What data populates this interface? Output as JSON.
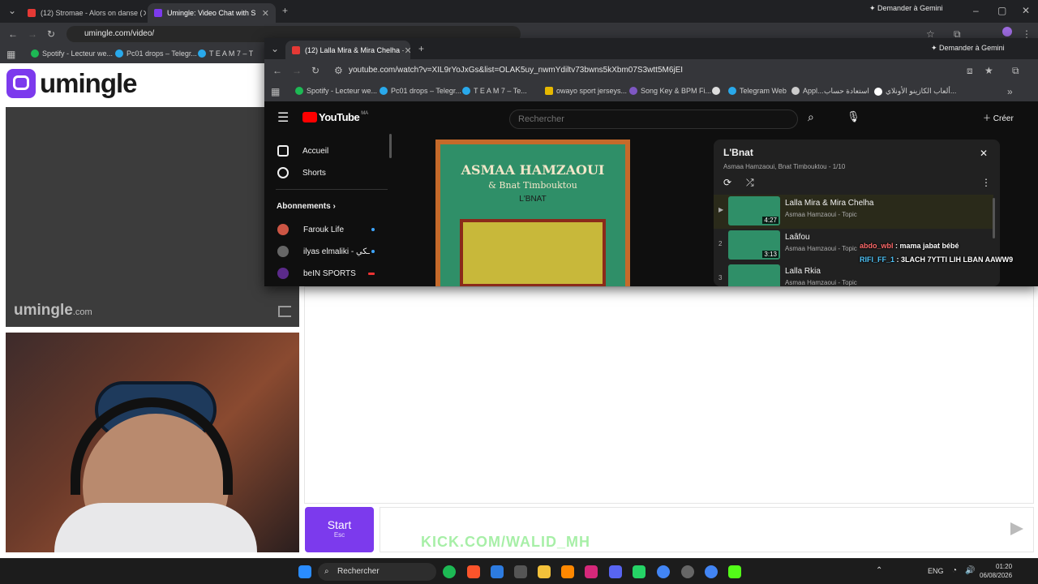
{
  "back_browser": {
    "tabs": [
      {
        "title": "(12) Stromae - Alors on danse (",
        "favicon_color": "#e53935",
        "active": false
      },
      {
        "title": "Umingle: Video Chat with S",
        "favicon_color": "#7c3aed",
        "active": true
      }
    ],
    "gemini_label": "Demander à Gemini",
    "url": "umingle.com/video/",
    "bookmarks": [
      "Spotify - Lecteur we...",
      "Pc01 drops – Telegr...",
      "T E A M 7 – T"
    ]
  },
  "umingle": {
    "logo_text": "umingle",
    "watermark": "umingle",
    "watermark_suffix": ".com",
    "start_label": "Start",
    "start_key": "Esc",
    "stream_watermark": "KICK.COM/WALID_MH"
  },
  "front_browser": {
    "tab_title": "(12) Lalla Mira & Mira Chelha ·",
    "gemini_label": "Demander à Gemini",
    "url": "youtube.com/watch?v=XIL9rYoJxGs&list=OLAK5uy_nwmYdiltv73bwns5kXbm07S3wtt5M6jEI",
    "bookmarks": [
      "Spotify - Lecteur we...",
      "Pc01 drops – Telegr...",
      "T E A M 7 – Te...",
      "owayo sport jerseys...",
      "Song Key & BPM Fi...",
      "Telegram Web",
      "Appl...",
      "استعادة حساب",
      "ألعاب الكازينو الأونلاي..."
    ]
  },
  "youtube": {
    "logo": "YouTube",
    "region": "MA",
    "search_placeholder": "Rechercher",
    "create_label": "Créer",
    "nav": [
      "Accueil",
      "Shorts"
    ],
    "subscriptions_header": "Abonnements",
    "subscriptions": [
      "Farouk Life",
      "ilyas elmaliki - ـكي",
      "beIN SPORTS"
    ],
    "album_artist": "ASMAA HAMZAOUI",
    "album_band": "& Bnat Timbouktou",
    "album_title": "L'BNAT",
    "playlist": {
      "title": "L'Bnat",
      "subtitle": "Asmaa Hamzaoui, Bnat Timbouktou - 1/10",
      "items": [
        {
          "index": "▶",
          "title": "Lalla Mira & Mira Chelha",
          "channel": "Asmaa Hamzaoui - Topic",
          "duration": "4:27"
        },
        {
          "index": "2",
          "title": "Laâfou",
          "channel": "Asmaa Hamzaoui - Topic",
          "duration": "3:13"
        },
        {
          "index": "3",
          "title": "Lalla Rkia",
          "channel": "Asmaa Hamzaoui - Topic",
          "duration": ""
        }
      ]
    }
  },
  "stream_chat": [
    {
      "user": "abdo_wbl",
      "message": "mama jabat bébé",
      "color": "#ff6b6b"
    },
    {
      "user": "RIFI_FF_1",
      "message": "3LACH 7YTTI LIH LBAN AAWW9",
      "color": "#4fc3f7"
    }
  ],
  "taskbar": {
    "search_placeholder": "Rechercher",
    "language": "ENG",
    "time": "01:20",
    "date": "06/08/2026"
  }
}
